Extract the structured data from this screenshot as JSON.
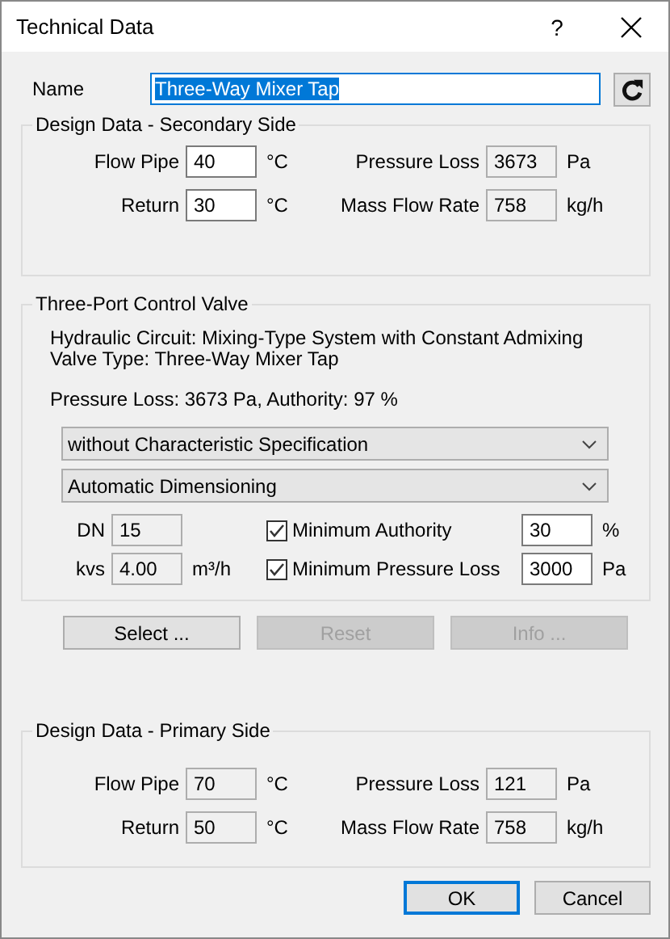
{
  "window": {
    "title": "Technical Data",
    "help": "?"
  },
  "name": {
    "label": "Name",
    "value": "Three-Way Mixer Tap",
    "text_selected": true
  },
  "secondary": {
    "title": "Design Data - Secondary Side",
    "fields": [
      {
        "label": "Flow Pipe",
        "value": "40",
        "unit": "°C",
        "readonly": false
      },
      {
        "label": "Pressure Loss",
        "value": "3673",
        "unit": "Pa",
        "readonly": true
      },
      {
        "label": "Return",
        "value": "30",
        "unit": "°C",
        "readonly": false
      },
      {
        "label": "Mass Flow Rate",
        "value": "758",
        "unit": "kg/h",
        "readonly": true
      }
    ]
  },
  "valve": {
    "title": "Three-Port Control Valve",
    "info_lines": [
      "Hydraulic Circuit: Mixing-Type System with Constant Admixing",
      "Valve Type: Three-Way Mixer Tap"
    ],
    "summary": "Pressure Loss: 3673 Pa, Authority: 97 %",
    "dropdowns": [
      {
        "value": "without Characteristic Specification"
      },
      {
        "value": "Automatic Dimensioning"
      }
    ],
    "sizes": [
      {
        "label": "DN",
        "value": "15",
        "readonly": true
      },
      {
        "label": "kvs",
        "value": "4.00",
        "unit": "m³/h",
        "readonly": true
      }
    ],
    "limits": [
      {
        "label": "Minimum Authority",
        "checked": true,
        "value": "30",
        "unit": "%"
      },
      {
        "label": "Minimum Pressure Loss",
        "checked": true,
        "value": "3000",
        "unit": "Pa"
      }
    ]
  },
  "actions": [
    {
      "label": "Select ...",
      "disabled": false
    },
    {
      "label": "Reset",
      "disabled": true
    },
    {
      "label": "Info ...",
      "disabled": true
    }
  ],
  "primary": {
    "title": "Design Data - Primary Side",
    "fields": [
      {
        "label": "Flow Pipe",
        "value": "70",
        "unit": "°C",
        "readonly": true
      },
      {
        "label": "Pressure Loss",
        "value": "121",
        "unit": "Pa",
        "readonly": true
      },
      {
        "label": "Return",
        "value": "50",
        "unit": "°C",
        "readonly": true
      },
      {
        "label": "Mass Flow Rate",
        "value": "758",
        "unit": "kg/h",
        "readonly": true
      }
    ]
  },
  "buttons": [
    {
      "label": "OK",
      "default": true
    },
    {
      "label": "Cancel",
      "default": false
    }
  ]
}
